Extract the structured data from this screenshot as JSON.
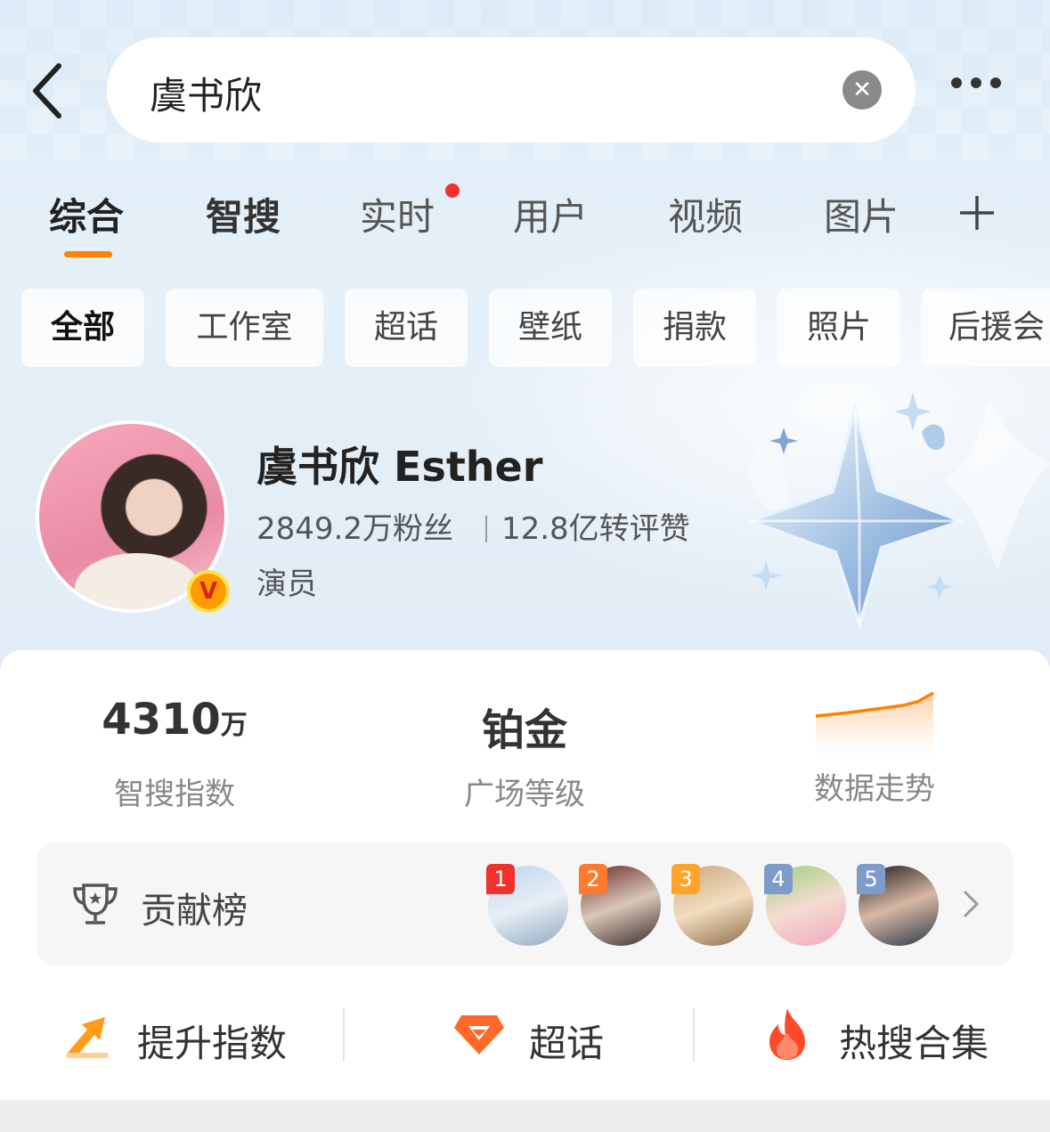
{
  "search": {
    "query": "虞书欣"
  },
  "tabs": [
    "综合",
    "智搜",
    "实时",
    "用户",
    "视频",
    "图片"
  ],
  "chips": [
    "全部",
    "工作室",
    "超话",
    "壁纸",
    "捐款",
    "照片",
    "后援会"
  ],
  "profile": {
    "name": "虞书欣 Esther",
    "followers": "2849.2万粉丝",
    "interactions": "12.8亿转评赞",
    "role": "演员",
    "verified_badge": "V"
  },
  "metrics": {
    "index_value": "4310",
    "index_unit": "万",
    "index_label": "智搜指数",
    "level_value": "铂金",
    "level_label": "广场等级",
    "trend_label": "数据走势"
  },
  "contrib": {
    "label": "贡献榜",
    "ranks": [
      "1",
      "2",
      "3",
      "4",
      "5"
    ]
  },
  "actions": {
    "boost": "提升指数",
    "supertopic": "超话",
    "hot": "热搜合集"
  },
  "colors": {
    "accent": "#ff8200",
    "dot": "#f0322c"
  }
}
